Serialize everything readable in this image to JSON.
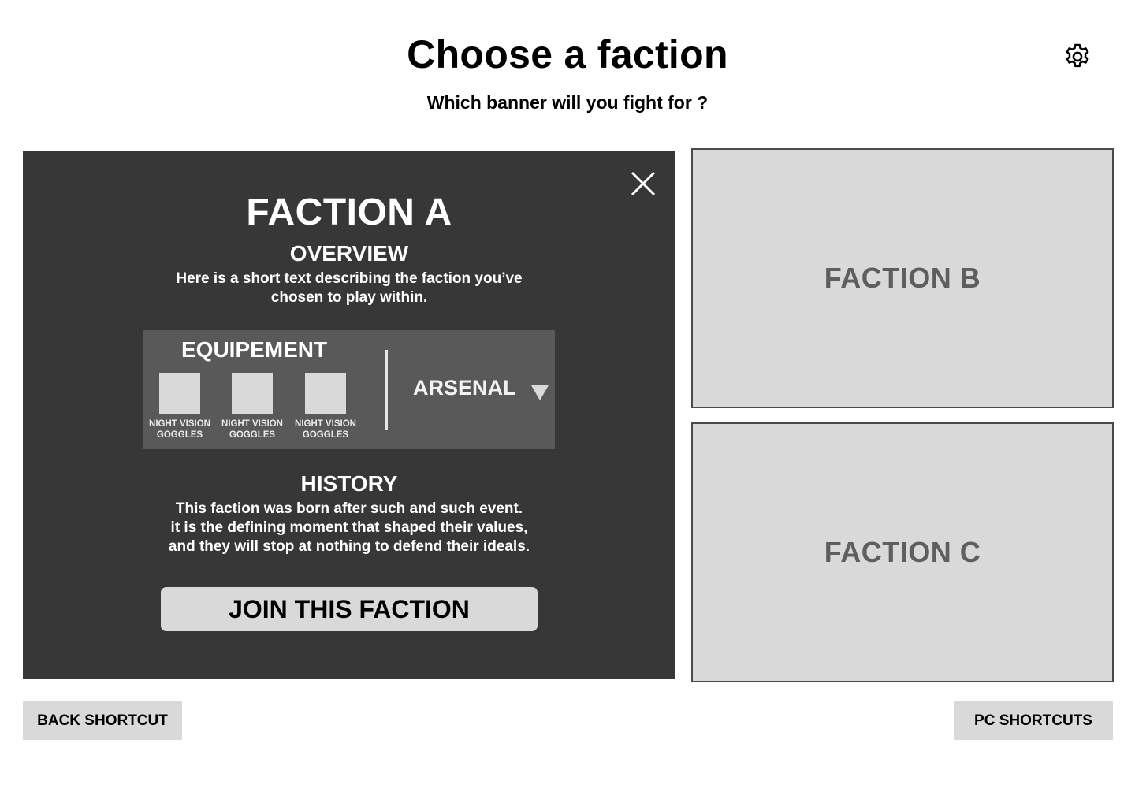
{
  "page": {
    "title": "Choose a faction",
    "subtitle": "Which banner will you fight for ?"
  },
  "header": {
    "settings_icon": "gear-icon"
  },
  "selected_faction": {
    "name": "FACTION A",
    "close_icon": "close-icon",
    "overview": {
      "title": "OVERVIEW",
      "text": "Here is a short text describing the faction you’ve chosen to play within."
    },
    "equipment": {
      "title": "EQUIPEMENT",
      "items": [
        {
          "label": "NIGHT VISION\nGOGGLES"
        },
        {
          "label": "NIGHT VISION\nGOGGLES"
        },
        {
          "label": "NIGHT VISION\nGOGGLES"
        }
      ],
      "arsenal_label": "ARSENAL",
      "arsenal_icon": "triangle-down-icon"
    },
    "history": {
      "title": "HISTORY",
      "text": "This faction was born after such and such event.\nit is the defining moment that shaped their values,\nand they will stop at nothing to defend their ideals."
    },
    "join_button": "JOIN THIS FACTION"
  },
  "other_factions": [
    {
      "name": "FACTION B"
    },
    {
      "name": "FACTION C"
    }
  ],
  "footer": {
    "back_shortcut": "BACK SHORTCUT",
    "pc_shortcuts": "PC SHORTCUTS"
  },
  "colors": {
    "panel_dark": "#373737",
    "equipment_box": "#595959",
    "card_light": "#d9d9d9",
    "card_text": "#5e5e5e"
  }
}
